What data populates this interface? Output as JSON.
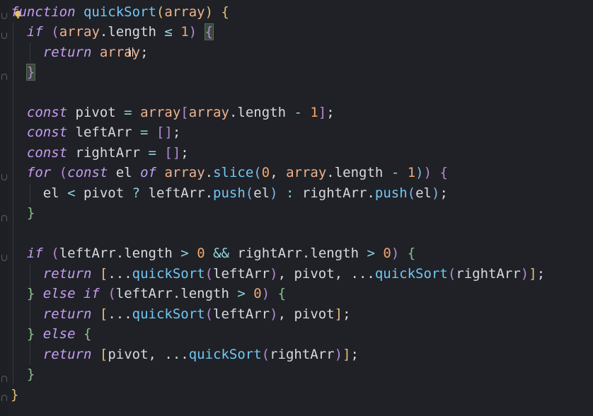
{
  "editor": {
    "language": "javascript",
    "lines": [
      {
        "segments": [
          {
            "t": "function",
            "c": "kw"
          },
          {
            "t": " ",
            "c": "pl"
          },
          {
            "t": "quickSort",
            "c": "fn"
          },
          {
            "t": "(",
            "c": "br1"
          },
          {
            "t": "array",
            "c": "var"
          },
          {
            "t": ")",
            "c": "br1"
          },
          {
            "t": " ",
            "c": "pl"
          },
          {
            "t": "{",
            "c": "br1"
          }
        ]
      },
      {
        "segments": [
          {
            "t": "  ",
            "c": "pl"
          },
          {
            "t": "if",
            "c": "kw"
          },
          {
            "t": " ",
            "c": "pl"
          },
          {
            "t": "(",
            "c": "br2"
          },
          {
            "t": "array",
            "c": "var"
          },
          {
            "t": ".length ",
            "c": "pl"
          },
          {
            "t": "≤",
            "c": "op"
          },
          {
            "t": " ",
            "c": "pl"
          },
          {
            "t": "1",
            "c": "num"
          },
          {
            "t": ")",
            "c": "br2"
          },
          {
            "t": " ",
            "c": "pl"
          },
          {
            "t": "{",
            "c": "br2 match"
          }
        ]
      },
      {
        "segments": [
          {
            "t": "    ",
            "c": "pl"
          },
          {
            "t": "return",
            "c": "kw"
          },
          {
            "t": " ",
            "c": "pl"
          },
          {
            "t": "array",
            "c": "var"
          },
          {
            "t": ";",
            "c": "pl"
          }
        ]
      },
      {
        "segments": [
          {
            "t": "  ",
            "c": "pl"
          },
          {
            "t": "}",
            "c": "br2 match"
          }
        ]
      },
      {
        "segments": []
      },
      {
        "segments": [
          {
            "t": "  ",
            "c": "pl"
          },
          {
            "t": "const",
            "c": "kw"
          },
          {
            "t": " pivot ",
            "c": "pl"
          },
          {
            "t": "=",
            "c": "op"
          },
          {
            "t": " ",
            "c": "pl"
          },
          {
            "t": "array",
            "c": "var"
          },
          {
            "t": "[",
            "c": "br2"
          },
          {
            "t": "array",
            "c": "var"
          },
          {
            "t": ".length ",
            "c": "pl"
          },
          {
            "t": "-",
            "c": "op"
          },
          {
            "t": " ",
            "c": "pl"
          },
          {
            "t": "1",
            "c": "num"
          },
          {
            "t": "]",
            "c": "br2"
          },
          {
            "t": ";",
            "c": "pl"
          }
        ]
      },
      {
        "segments": [
          {
            "t": "  ",
            "c": "pl"
          },
          {
            "t": "const",
            "c": "kw"
          },
          {
            "t": " leftArr ",
            "c": "pl"
          },
          {
            "t": "=",
            "c": "op"
          },
          {
            "t": " ",
            "c": "pl"
          },
          {
            "t": "[]",
            "c": "br2"
          },
          {
            "t": ";",
            "c": "pl"
          }
        ]
      },
      {
        "segments": [
          {
            "t": "  ",
            "c": "pl"
          },
          {
            "t": "const",
            "c": "kw"
          },
          {
            "t": " rightArr ",
            "c": "pl"
          },
          {
            "t": "=",
            "c": "op"
          },
          {
            "t": " ",
            "c": "pl"
          },
          {
            "t": "[]",
            "c": "br2"
          },
          {
            "t": ";",
            "c": "pl"
          }
        ]
      },
      {
        "segments": [
          {
            "t": "  ",
            "c": "pl"
          },
          {
            "t": "for",
            "c": "kw"
          },
          {
            "t": " ",
            "c": "pl"
          },
          {
            "t": "(",
            "c": "br2"
          },
          {
            "t": "const",
            "c": "kw"
          },
          {
            "t": " el ",
            "c": "pl"
          },
          {
            "t": "of",
            "c": "kw"
          },
          {
            "t": " ",
            "c": "pl"
          },
          {
            "t": "array",
            "c": "var"
          },
          {
            "t": ".",
            "c": "pl"
          },
          {
            "t": "slice",
            "c": "fn"
          },
          {
            "t": "(",
            "c": "br3"
          },
          {
            "t": "0",
            "c": "num"
          },
          {
            "t": ", ",
            "c": "pl"
          },
          {
            "t": "array",
            "c": "var"
          },
          {
            "t": ".length ",
            "c": "pl"
          },
          {
            "t": "-",
            "c": "op"
          },
          {
            "t": " ",
            "c": "pl"
          },
          {
            "t": "1",
            "c": "num"
          },
          {
            "t": ")",
            "c": "br3"
          },
          {
            "t": ")",
            "c": "br2"
          },
          {
            "t": " ",
            "c": "pl"
          },
          {
            "t": "{",
            "c": "br2"
          }
        ]
      },
      {
        "segments": [
          {
            "t": "    el ",
            "c": "pl"
          },
          {
            "t": "<",
            "c": "op"
          },
          {
            "t": " pivot ",
            "c": "pl"
          },
          {
            "t": "?",
            "c": "op"
          },
          {
            "t": " leftArr.",
            "c": "pl"
          },
          {
            "t": "push",
            "c": "fn"
          },
          {
            "t": "(",
            "c": "br3"
          },
          {
            "t": "el",
            "c": "pl"
          },
          {
            "t": ")",
            "c": "br3"
          },
          {
            "t": " ",
            "c": "pl"
          },
          {
            "t": ":",
            "c": "op"
          },
          {
            "t": " rightArr.",
            "c": "pl"
          },
          {
            "t": "push",
            "c": "fn"
          },
          {
            "t": "(",
            "c": "br3"
          },
          {
            "t": "el",
            "c": "pl"
          },
          {
            "t": ")",
            "c": "br3"
          },
          {
            "t": ";",
            "c": "pl"
          }
        ]
      },
      {
        "segments": [
          {
            "t": "  ",
            "c": "pl"
          },
          {
            "t": "}",
            "c": "br4"
          }
        ]
      },
      {
        "segments": []
      },
      {
        "segments": [
          {
            "t": "  ",
            "c": "pl"
          },
          {
            "t": "if",
            "c": "kw"
          },
          {
            "t": " ",
            "c": "pl"
          },
          {
            "t": "(",
            "c": "br2"
          },
          {
            "t": "leftArr.length ",
            "c": "pl"
          },
          {
            "t": ">",
            "c": "op"
          },
          {
            "t": " ",
            "c": "pl"
          },
          {
            "t": "0",
            "c": "num"
          },
          {
            "t": " ",
            "c": "pl"
          },
          {
            "t": "&&",
            "c": "op"
          },
          {
            "t": " rightArr.length ",
            "c": "pl"
          },
          {
            "t": ">",
            "c": "op"
          },
          {
            "t": " ",
            "c": "pl"
          },
          {
            "t": "0",
            "c": "num"
          },
          {
            "t": ")",
            "c": "br2"
          },
          {
            "t": " ",
            "c": "pl"
          },
          {
            "t": "{",
            "c": "br4"
          }
        ]
      },
      {
        "segments": [
          {
            "t": "    ",
            "c": "pl"
          },
          {
            "t": "return",
            "c": "kw"
          },
          {
            "t": " ",
            "c": "pl"
          },
          {
            "t": "[",
            "c": "br1"
          },
          {
            "t": "...",
            "c": "pl"
          },
          {
            "t": "quickSort",
            "c": "fn"
          },
          {
            "t": "(",
            "c": "br2"
          },
          {
            "t": "leftArr",
            "c": "pl"
          },
          {
            "t": ")",
            "c": "br2"
          },
          {
            "t": ", pivot, ...",
            "c": "pl"
          },
          {
            "t": "quickSort",
            "c": "fn"
          },
          {
            "t": "(",
            "c": "br2"
          },
          {
            "t": "rightArr",
            "c": "pl"
          },
          {
            "t": ")",
            "c": "br2"
          },
          {
            "t": "]",
            "c": "br1"
          },
          {
            "t": ";",
            "c": "pl"
          }
        ]
      },
      {
        "segments": [
          {
            "t": "  ",
            "c": "pl"
          },
          {
            "t": "}",
            "c": "br4"
          },
          {
            "t": " ",
            "c": "pl"
          },
          {
            "t": "else if",
            "c": "kw"
          },
          {
            "t": " ",
            "c": "pl"
          },
          {
            "t": "(",
            "c": "br2"
          },
          {
            "t": "leftArr.length ",
            "c": "pl"
          },
          {
            "t": ">",
            "c": "op"
          },
          {
            "t": " ",
            "c": "pl"
          },
          {
            "t": "0",
            "c": "num"
          },
          {
            "t": ")",
            "c": "br2"
          },
          {
            "t": " ",
            "c": "pl"
          },
          {
            "t": "{",
            "c": "br4"
          }
        ]
      },
      {
        "segments": [
          {
            "t": "    ",
            "c": "pl"
          },
          {
            "t": "return",
            "c": "kw"
          },
          {
            "t": " ",
            "c": "pl"
          },
          {
            "t": "[",
            "c": "br1"
          },
          {
            "t": "...",
            "c": "pl"
          },
          {
            "t": "quickSort",
            "c": "fn"
          },
          {
            "t": "(",
            "c": "br2"
          },
          {
            "t": "leftArr",
            "c": "pl"
          },
          {
            "t": ")",
            "c": "br2"
          },
          {
            "t": ", pivot",
            "c": "pl"
          },
          {
            "t": "]",
            "c": "br1"
          },
          {
            "t": ";",
            "c": "pl"
          }
        ]
      },
      {
        "segments": [
          {
            "t": "  ",
            "c": "pl"
          },
          {
            "t": "}",
            "c": "br4"
          },
          {
            "t": " ",
            "c": "pl"
          },
          {
            "t": "else",
            "c": "kw"
          },
          {
            "t": " ",
            "c": "pl"
          },
          {
            "t": "{",
            "c": "br4"
          }
        ]
      },
      {
        "segments": [
          {
            "t": "    ",
            "c": "pl"
          },
          {
            "t": "return",
            "c": "kw"
          },
          {
            "t": " ",
            "c": "pl"
          },
          {
            "t": "[",
            "c": "br1"
          },
          {
            "t": "pivot, ...",
            "c": "pl"
          },
          {
            "t": "quickSort",
            "c": "fn"
          },
          {
            "t": "(",
            "c": "br2"
          },
          {
            "t": "rightArr",
            "c": "pl"
          },
          {
            "t": ")",
            "c": "br2"
          },
          {
            "t": "]",
            "c": "br1"
          },
          {
            "t": ";",
            "c": "pl"
          }
        ]
      },
      {
        "segments": [
          {
            "t": "  ",
            "c": "pl"
          },
          {
            "t": "}",
            "c": "br4"
          }
        ]
      },
      {
        "segments": [
          {
            "t": "}",
            "c": "br1"
          }
        ]
      }
    ]
  },
  "icons": {
    "bulb": "lightbulb-icon",
    "cursor": "text-cursor-icon"
  },
  "colors": {
    "background": "#1f2127",
    "keyword": "#c69cf0",
    "function": "#72c7f3",
    "parameter": "#f0b28d",
    "number": "#f3a56b",
    "text": "#d6d9df"
  }
}
